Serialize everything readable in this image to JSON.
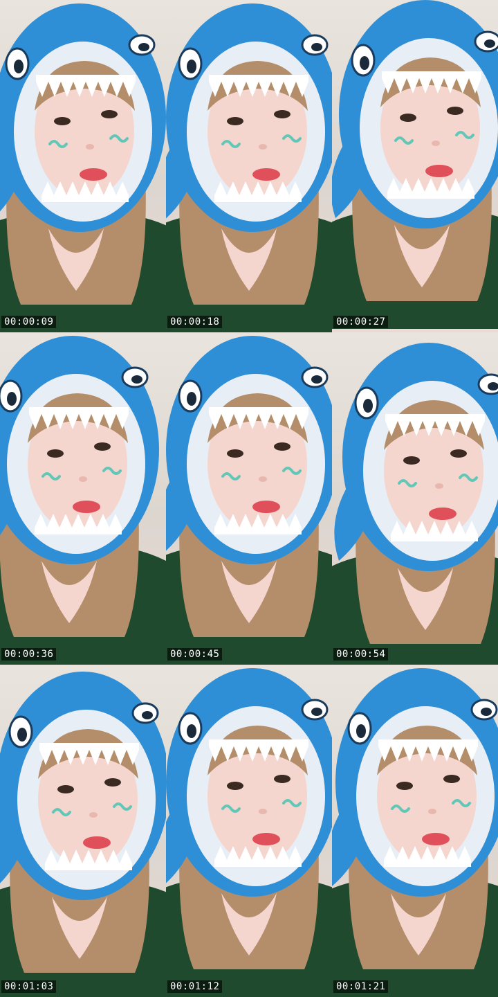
{
  "frames": [
    {
      "timestamp": "00:00:09",
      "thumbnail": "video-frame"
    },
    {
      "timestamp": "00:00:18",
      "thumbnail": "video-frame"
    },
    {
      "timestamp": "00:00:27",
      "thumbnail": "video-frame"
    },
    {
      "timestamp": "00:00:36",
      "thumbnail": "video-frame"
    },
    {
      "timestamp": "00:00:45",
      "thumbnail": "video-frame"
    },
    {
      "timestamp": "00:00:54",
      "thumbnail": "video-frame"
    },
    {
      "timestamp": "00:01:03",
      "thumbnail": "video-frame"
    },
    {
      "timestamp": "00:01:12",
      "thumbnail": "video-frame"
    },
    {
      "timestamp": "00:01:21",
      "thumbnail": "video-frame"
    }
  ],
  "colors": {
    "shark_blue": "#2f8fd6",
    "shark_inner": "#e7eef5",
    "hair": "#b48e6a",
    "skin": "#f4d6cf",
    "shirt": "#1f4a2e",
    "cheek_mark": "#63c7b8",
    "lips": "#e0505a",
    "timestamp_bg": "#000000",
    "timestamp_text": "#ffffff"
  }
}
